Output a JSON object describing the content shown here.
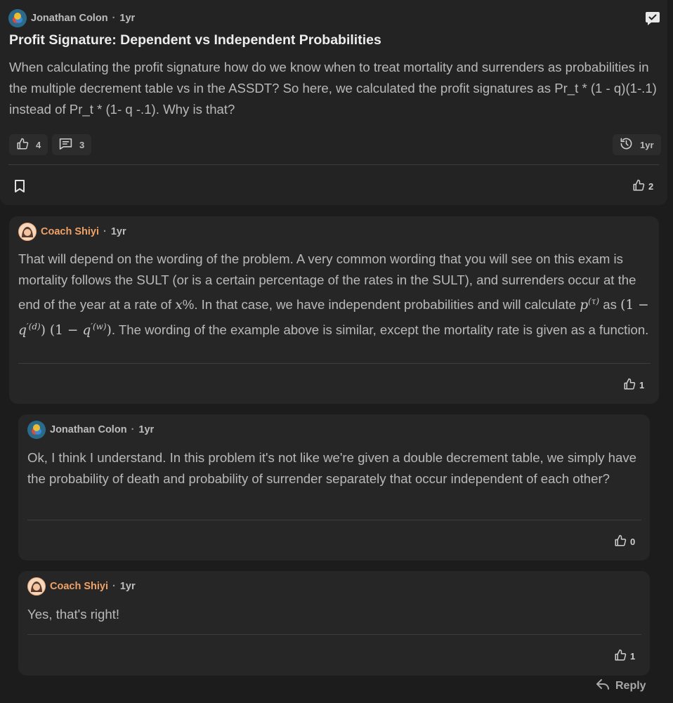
{
  "post": {
    "author": "Jonathan Colon",
    "time": "1yr",
    "title": "Profit Signature: Dependent vs Independent Probabilities",
    "body": "When calculating the profit signature how do we know when to treat mortality and surrenders as probabilities in the multiple decrement table vs in the ASSDT? So here, we calculated the profit signatures as Pr_t * (1 - q)(1-.1) instead of Pr_t * (1- q -.1). Why is that?",
    "likes": "4",
    "comments": "3",
    "history_time": "1yr",
    "answer_likes": "2"
  },
  "comments": [
    {
      "author": "Coach Shiyi",
      "time": "1yr",
      "text_a": "That will depend on the wording of the problem. A very common wording that you will see on this exam is mortality follows the SULT (or is a certain percentage of the rates in the SULT), and surrenders occur at the end of the year at a rate of",
      "text_b": "%. In that case, we have independent probabilities and will calculate",
      "text_c": "as",
      "text_d": ". The wording of the example above is similar, except the mortality rate is given as a function.",
      "likes": "1"
    },
    {
      "author": "Jonathan Colon",
      "time": "1yr",
      "text": "Ok, I think I understand. In this problem it's not like we're given a double decrement table, we simply have the probability of death and probability of surrender separately that occur independent of each other?",
      "likes": "0"
    },
    {
      "author": "Coach Shiyi",
      "time": "1yr",
      "text": "Yes, that's right!",
      "likes": "1"
    }
  ],
  "reply_label": "Reply",
  "separator": "·",
  "icons": {
    "thumbs_up": "thumbs-up-icon",
    "comments": "comment-icon",
    "history": "history-icon",
    "bookmark": "bookmark-icon",
    "chat": "chat-check-icon",
    "reply": "reply-icon"
  }
}
